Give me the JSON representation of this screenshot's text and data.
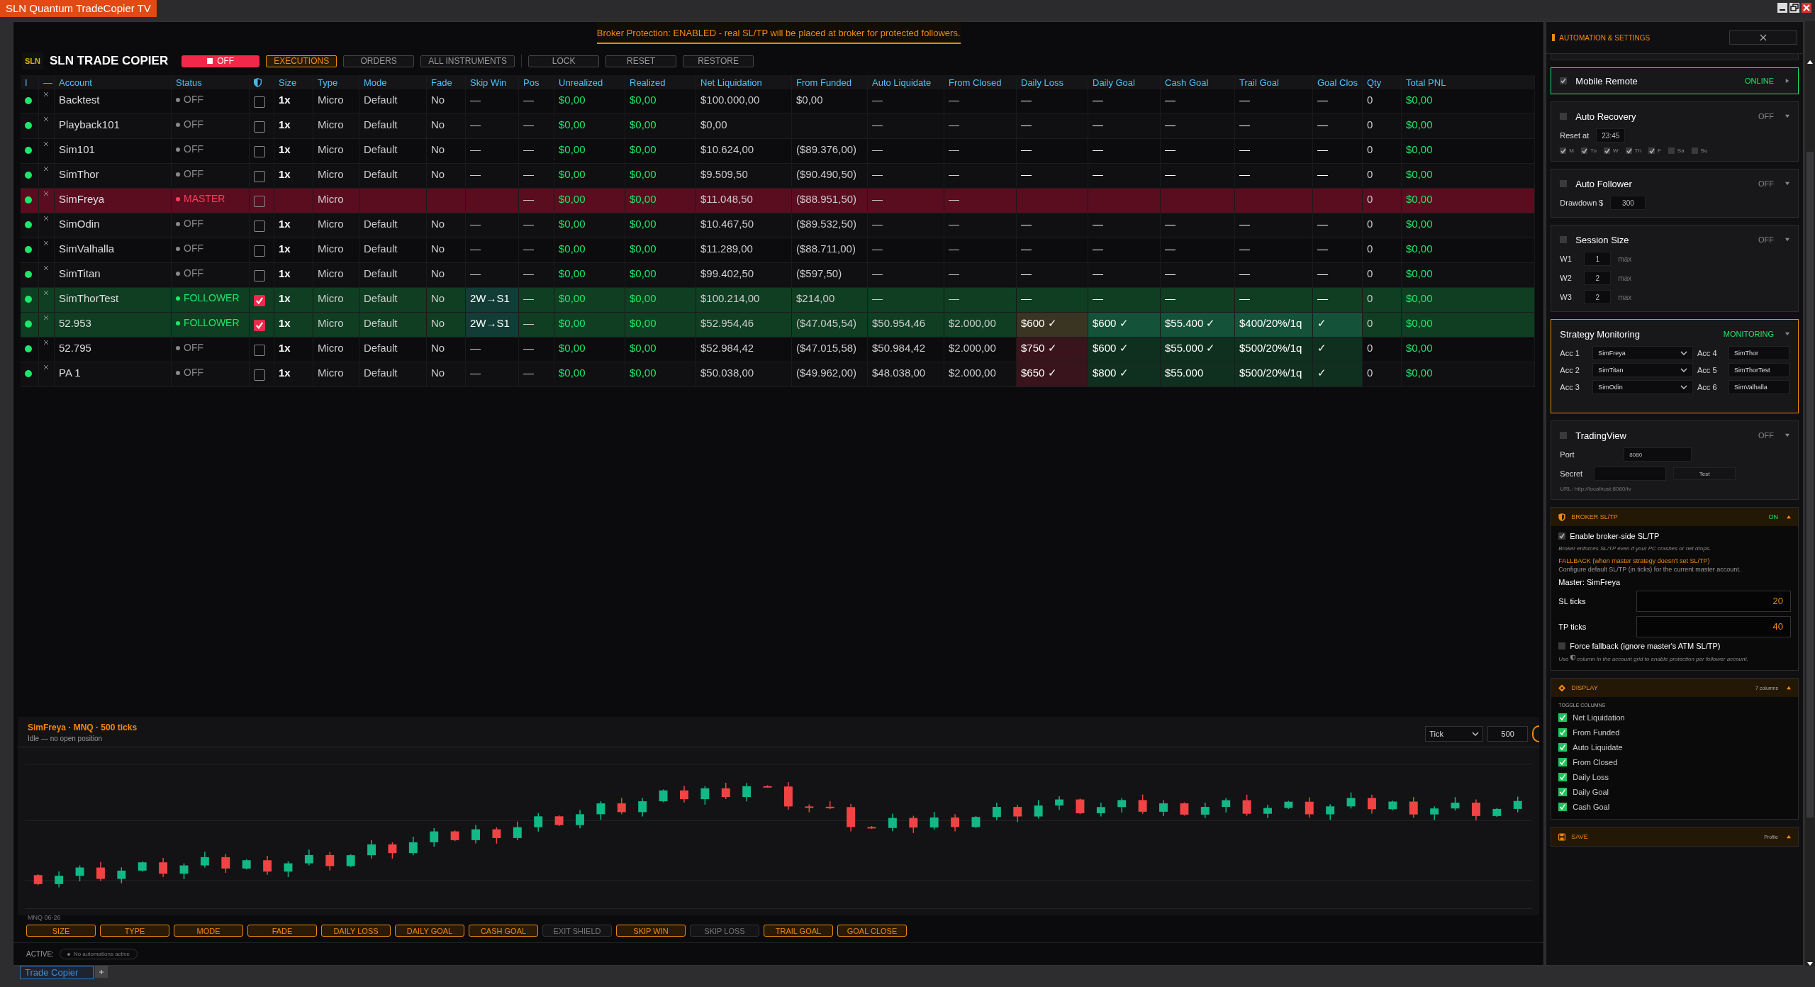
{
  "window": {
    "title": "SLN Quantum TradeCopier TV"
  },
  "banner": "Broker Protection: ENABLED - real SL/TP will be placed at broker for protected followers.",
  "toolbar": {
    "logo": "SLN",
    "title": "SLN TRADE COPIER",
    "power": {
      "label": "OFF",
      "on": false
    },
    "buttons": [
      {
        "label": "EXECUTIONS",
        "selected": true
      },
      {
        "label": "ORDERS",
        "selected": false
      },
      {
        "label": "ALL INSTRUMENTS",
        "selected": false
      }
    ],
    "actions": [
      "LOCK",
      "RESET",
      "RESTORE"
    ]
  },
  "table": {
    "columns": [
      {
        "kind": "text",
        "label": "I"
      },
      {
        "kind": "text",
        "label": "—"
      },
      {
        "kind": "text",
        "label": "Account"
      },
      {
        "kind": "text",
        "label": "Status"
      },
      {
        "kind": "shield"
      },
      {
        "kind": "text",
        "label": "Size"
      },
      {
        "kind": "text",
        "label": "Type"
      },
      {
        "kind": "text",
        "label": "Mode"
      },
      {
        "kind": "text",
        "label": "Fade"
      },
      {
        "kind": "text",
        "label": "Skip Win"
      },
      {
        "kind": "text",
        "label": "Pos"
      },
      {
        "kind": "text",
        "label": "Unrealized"
      },
      {
        "kind": "text",
        "label": "Realized"
      },
      {
        "kind": "text",
        "label": "Net Liquidation"
      },
      {
        "kind": "text",
        "label": "From Funded"
      },
      {
        "kind": "text",
        "label": "Auto Liquidate"
      },
      {
        "kind": "text",
        "label": "From Closed"
      },
      {
        "kind": "text",
        "label": "Daily Loss"
      },
      {
        "kind": "text",
        "label": "Daily Goal"
      },
      {
        "kind": "text",
        "label": "Cash Goal"
      },
      {
        "kind": "text",
        "label": "Trail Goal"
      },
      {
        "kind": "text",
        "label": "Goal Clos"
      },
      {
        "kind": "text",
        "label": "Qty"
      },
      {
        "kind": "text",
        "label": "Total PNL"
      }
    ],
    "rows": [
      {
        "connected": true,
        "kind": "off",
        "protected": false,
        "limits_armed": false,
        "cells": [
          null,
          null,
          "Backtest",
          "OFF",
          null,
          "1x",
          "Micro",
          "Default",
          "No",
          "—",
          "—",
          "$0,00",
          "$0,00",
          "$100.000,00",
          "$0,00",
          "—",
          "—",
          "—",
          "—",
          "—",
          "—",
          "—",
          "0",
          "$0,00"
        ]
      },
      {
        "connected": true,
        "kind": "off",
        "protected": false,
        "limits_armed": false,
        "cells": [
          null,
          null,
          "Playback101",
          "OFF",
          null,
          "1x",
          "Micro",
          "Default",
          "No",
          "—",
          "—",
          "$0,00",
          "$0,00",
          "$0,00",
          null,
          "—",
          "—",
          "—",
          "—",
          "—",
          "—",
          "—",
          "0",
          "$0,00"
        ]
      },
      {
        "connected": true,
        "kind": "off",
        "protected": false,
        "limits_armed": false,
        "cells": [
          null,
          null,
          "Sim101",
          "OFF",
          null,
          "1x",
          "Micro",
          "Default",
          "No",
          "—",
          "—",
          "$0,00",
          "$0,00",
          "$10.624,00",
          "($89.376,00)",
          "—",
          "—",
          "—",
          "—",
          "—",
          "—",
          "—",
          "0",
          "$0,00"
        ]
      },
      {
        "connected": true,
        "kind": "off",
        "protected": false,
        "limits_armed": false,
        "cells": [
          null,
          null,
          "SimThor",
          "OFF",
          null,
          "1x",
          "Micro",
          "Default",
          "No",
          "—",
          "—",
          "$0,00",
          "$0,00",
          "$9.509,50",
          "($90.490,50)",
          "—",
          "—",
          "—",
          "—",
          "—",
          "—",
          "—",
          "0",
          "$0,00"
        ]
      },
      {
        "connected": true,
        "kind": "master",
        "protected": false,
        "limits_armed": false,
        "cells": [
          null,
          null,
          "SimFreya",
          "MASTER",
          null,
          null,
          "Micro",
          null,
          null,
          null,
          "—",
          "$0,00",
          "$0,00",
          "$11.048,50",
          "($88.951,50)",
          "—",
          "—",
          null,
          null,
          null,
          null,
          null,
          "0",
          "$0,00"
        ]
      },
      {
        "connected": true,
        "kind": "off",
        "protected": false,
        "limits_armed": false,
        "cells": [
          null,
          null,
          "SimOdin",
          "OFF",
          null,
          "1x",
          "Micro",
          "Default",
          "No",
          "—",
          "—",
          "$0,00",
          "$0,00",
          "$10.467,50",
          "($89.532,50)",
          "—",
          "—",
          "—",
          "—",
          "—",
          "—",
          "—",
          "0",
          "$0,00"
        ]
      },
      {
        "connected": true,
        "kind": "off",
        "protected": false,
        "limits_armed": false,
        "cells": [
          null,
          null,
          "SimValhalla",
          "OFF",
          null,
          "1x",
          "Micro",
          "Default",
          "No",
          "—",
          "—",
          "$0,00",
          "$0,00",
          "$11.289,00",
          "($88.711,00)",
          "—",
          "—",
          "—",
          "—",
          "—",
          "—",
          "—",
          "0",
          "$0,00"
        ]
      },
      {
        "connected": true,
        "kind": "off",
        "protected": false,
        "limits_armed": false,
        "cells": [
          null,
          null,
          "SimTitan",
          "OFF",
          null,
          "1x",
          "Micro",
          "Default",
          "No",
          "—",
          "—",
          "$0,00",
          "$0,00",
          "$99.402,50",
          "($597,50)",
          "—",
          "—",
          "—",
          "—",
          "—",
          "—",
          "—",
          "0",
          "$0,00"
        ]
      },
      {
        "connected": true,
        "kind": "follower",
        "protected": true,
        "limits_armed": false,
        "cells": [
          null,
          null,
          "SimThorTest",
          "FOLLOWER",
          null,
          "1x",
          "Micro",
          "Default",
          "No",
          "2W→S1",
          "—",
          "$0,00",
          "$0,00",
          "$100.214,00",
          "$214,00",
          "—",
          "—",
          "—",
          "—",
          "—",
          "—",
          "—",
          "0",
          "$0,00"
        ]
      },
      {
        "connected": true,
        "kind": "follower",
        "protected": true,
        "limits_armed": true,
        "cells": [
          null,
          null,
          "52.953",
          "FOLLOWER",
          null,
          "1x",
          "Micro",
          "Default",
          "No",
          "2W→S1",
          "—",
          "$0,00",
          "$0,00",
          "$52.954,46",
          "($47.045,54)",
          "$50.954,46",
          "$2.000,00",
          "$600 ✓",
          "$600 ✓",
          "$55.400 ✓",
          "$400/20%/1q",
          "✓",
          "0",
          "$0,00"
        ]
      },
      {
        "connected": true,
        "kind": "off",
        "protected": false,
        "limits_armed": true,
        "cells": [
          null,
          null,
          "52.795",
          "OFF",
          null,
          "1x",
          "Micro",
          "Default",
          "No",
          "—",
          "—",
          "$0,00",
          "$0,00",
          "$52.984,42",
          "($47.015,58)",
          "$50.984,42",
          "$2.000,00",
          "$750 ✓",
          "$600 ✓",
          "$55.000 ✓",
          "$500/20%/1q",
          "✓",
          "0",
          "$0,00"
        ]
      },
      {
        "connected": true,
        "kind": "off",
        "protected": false,
        "limits_armed": true,
        "cells": [
          null,
          null,
          "PA 1",
          "OFF",
          null,
          "1x",
          "Micro",
          "Default",
          "No",
          "—",
          "—",
          "$0,00",
          "$0,00",
          "$50.038,00",
          "($49.962,00)",
          "$48.038,00",
          "$2.000,00",
          "$650 ✓",
          "$800 ✓",
          "$55.000",
          "$500/20%/1q",
          "✓",
          "0",
          "$0,00"
        ]
      }
    ]
  },
  "chart": {
    "title": "SimFreya · MNQ · 500 ticks",
    "subtitle": "Idle — no open position",
    "interval": "Tick",
    "size": "500",
    "symbol": "MNQ 06-26"
  },
  "toggles": [
    {
      "label": "SIZE",
      "on": true
    },
    {
      "label": "TYPE",
      "on": true
    },
    {
      "label": "MODE",
      "on": true
    },
    {
      "label": "FADE",
      "on": true
    },
    {
      "label": "DAILY LOSS",
      "on": true
    },
    {
      "label": "DAILY GOAL",
      "on": true
    },
    {
      "label": "CASH GOAL",
      "on": true
    },
    {
      "label": "EXIT SHIELD",
      "on": false
    },
    {
      "label": "SKIP WIN",
      "on": true
    },
    {
      "label": "SKIP LOSS",
      "on": false
    },
    {
      "label": "TRAIL GOAL",
      "on": true
    },
    {
      "label": "GOAL CLOSE",
      "on": true
    }
  ],
  "active": {
    "label": "ACTIVE:",
    "value": "No automations active"
  },
  "tabs": [
    {
      "label": "Trade Copier",
      "selected": true
    }
  ],
  "panel": {
    "title": "AUTOMATION & SETTINGS",
    "mobile_remote": {
      "label": "Mobile Remote",
      "checked": true,
      "status": "ONLINE",
      "active": true
    },
    "auto_recovery": {
      "label": "Auto Recovery",
      "checked": false,
      "status": "OFF",
      "active": false,
      "reset_label": "Reset at",
      "reset_time": "23:45",
      "days": [
        {
          "label": "M",
          "checked": true
        },
        {
          "label": "Tu",
          "checked": true
        },
        {
          "label": "W",
          "checked": true
        },
        {
          "label": "Th",
          "checked": true
        },
        {
          "label": "F",
          "checked": true
        },
        {
          "label": "Sa",
          "checked": false
        },
        {
          "label": "Su",
          "checked": false
        }
      ]
    },
    "auto_follower": {
      "label": "Auto Follower",
      "checked": false,
      "status": "OFF",
      "active": false,
      "drawdown_label": "Drawdown $",
      "drawdown": "300"
    },
    "session_size": {
      "label": "Session Size",
      "checked": false,
      "status": "OFF",
      "active": false,
      "sizes": [
        {
          "label": "W1",
          "value": "1",
          "unit": "max"
        },
        {
          "label": "W2",
          "value": "2",
          "unit": "max"
        },
        {
          "label": "W3",
          "value": "2",
          "unit": "max"
        }
      ]
    },
    "strategy_monitoring": {
      "label": "Strategy Monitoring",
      "status": "MONITORING",
      "active": true,
      "accounts": [
        {
          "label": "Acc 1",
          "value": "SimFreya",
          "kind": "select"
        },
        {
          "label": "Acc 4",
          "value": "SimThor",
          "kind": "input"
        },
        {
          "label": "Acc 2",
          "value": "SimTitan",
          "kind": "select"
        },
        {
          "label": "Acc 5",
          "value": "SimThorTest",
          "kind": "input"
        },
        {
          "label": "Acc 3",
          "value": "SimOdin",
          "kind": "select"
        },
        {
          "label": "Acc 6",
          "value": "SimValhalla",
          "kind": "input"
        }
      ]
    },
    "tradingview": {
      "label": "TradingView",
      "checked": false,
      "status": "OFF",
      "active": false,
      "port_label": "Port",
      "port": "8080",
      "secret_label": "Secret",
      "test_button": "Test",
      "url": "URL: http://localhost:8080/tv"
    },
    "broker": {
      "title": "BROKER SL/TP",
      "status": "ON",
      "active": true,
      "expanded": true,
      "enable": {
        "label": "Enable broker-side SL/TP",
        "checked": true
      },
      "note": "Broker enforces SL/TP even if your PC crashes or net drops.",
      "fallback_title": "FALLBACK (when master strategy doesn't set SL/TP)",
      "fallback_text": "Configure default SL/TP (in ticks) for the current master account.",
      "master": "Master: SimFreya",
      "sl_label": "SL ticks",
      "sl": "20",
      "tp_label": "TP ticks",
      "tp": "40",
      "force": {
        "label": "Force fallback (ignore master's ATM SL/TP)",
        "checked": false
      },
      "hint_before": "Use",
      "hint_after": "column in the account grid to enable protection per follower account."
    },
    "display": {
      "title": "DISPLAY",
      "count": "7 columns",
      "expanded": true,
      "subtitle": "TOGGLE COLUMNS",
      "columns": [
        {
          "label": "Net Liquidation",
          "checked": true
        },
        {
          "label": "From Funded",
          "checked": true
        },
        {
          "label": "Auto Liquidate",
          "checked": true
        },
        {
          "label": "From Closed",
          "checked": true
        },
        {
          "label": "Daily Loss",
          "checked": true
        },
        {
          "label": "Daily Goal",
          "checked": true
        },
        {
          "label": "Cash Goal",
          "checked": true
        }
      ]
    },
    "save": {
      "title": "SAVE",
      "profile": "Profile",
      "expanded": true
    }
  }
}
